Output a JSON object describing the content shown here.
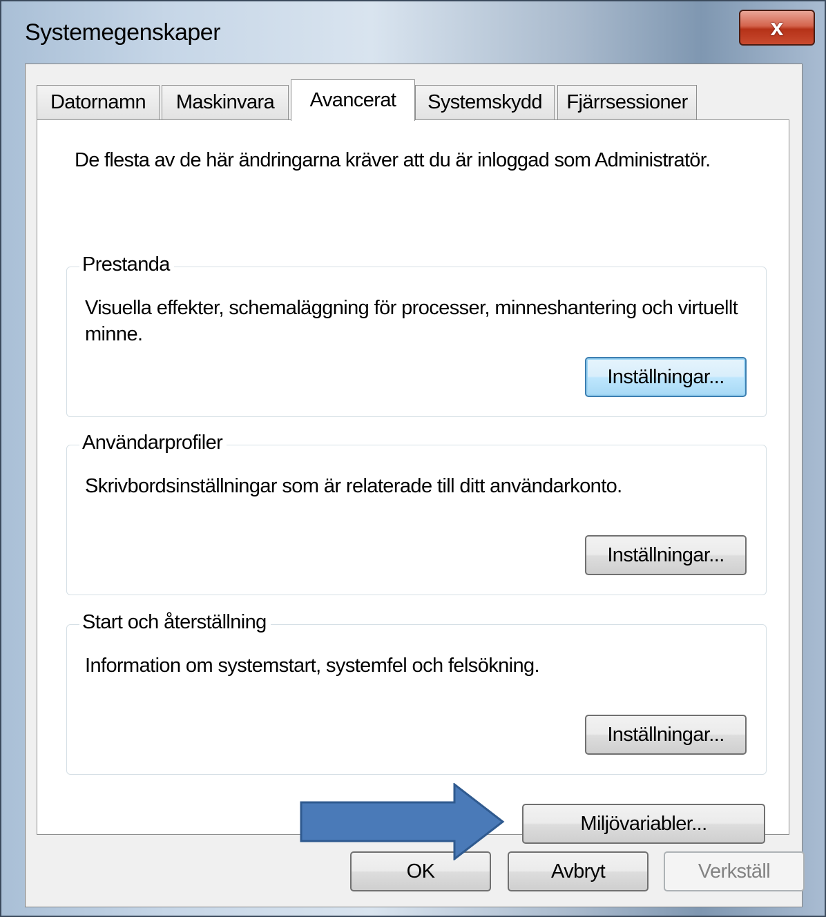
{
  "window": {
    "title": "Systemegenskaper",
    "close_label": "x"
  },
  "tabs": [
    {
      "label": "Datornamn",
      "active": false
    },
    {
      "label": "Maskinvara",
      "active": false
    },
    {
      "label": "Avancerat",
      "active": true
    },
    {
      "label": "Systemskydd",
      "active": false
    },
    {
      "label": "Fjärrsessioner",
      "active": false
    }
  ],
  "advanced": {
    "info_text": "De flesta av de här ändringarna kräver att du är inloggad som Administratör.",
    "performance": {
      "title": "Prestanda",
      "description": "Visuella effekter, schemaläggning för processer, minneshantering och virtuellt minne.",
      "button_label": "Inställningar..."
    },
    "user_profiles": {
      "title": "Användarprofiler",
      "description": "Skrivbordsinställningar som är relaterade till ditt användarkonto.",
      "button_label": "Inställningar..."
    },
    "startup_recovery": {
      "title": "Start och återställning",
      "description": "Information om systemstart, systemfel och felsökning.",
      "button_label": "Inställningar..."
    },
    "env_button_label": "Miljövariabler..."
  },
  "footer": {
    "ok_label": "OK",
    "cancel_label": "Avbryt",
    "apply_label": "Verkställ"
  },
  "colors": {
    "arrow_fill": "#4a7ab8",
    "arrow_stroke": "#2f5a8f",
    "close_button": "#c94a2f"
  }
}
